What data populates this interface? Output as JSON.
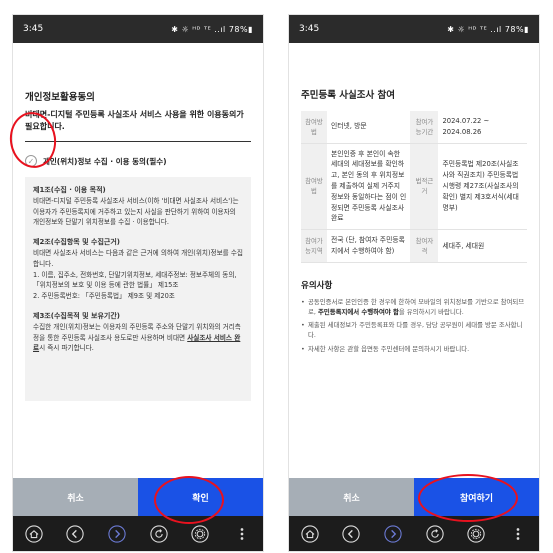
{
  "left": {
    "status": {
      "time": "3:45",
      "indicators": "✱ ☼ ᴴᴰ ᵀᴱ ..ıl 78%▮"
    },
    "title": "개인정보활용동의",
    "subtitle": "비대면-디지털 주민등록 사실조사 서비스 사용을 위한 이용동의가 필요합니다.",
    "check_label": "개인(위치)정보 수집 · 이용 동의(필수)",
    "terms": {
      "s1_title": "제1조(수집 · 이용 목적)",
      "s1_body": "비대면-디지털 주민등록 사실조사 서비스(이하 '비대면 사실조사 서비스')는 이용자가 주민등록지에 거주하고 있는지 사실을 판단하기 위하여 이용자의 개인정보와 단말기 위치정보를 수집 · 이용합니다.",
      "s2_title": "제2조(수집항목 및 수집근거)",
      "s2_body": "비대면 사실조사 서비스는 다음과 같은 근거에 의하여 개인(위치)정보를 수집합니다.",
      "s2_item1": "1. 이름, 집주소, 전화번호, 단말기위치정보, 세대주정보: 정보주체의 동의, 「위치정보의 보호 및 이용 등에 관한 법률」 제15조",
      "s2_item2": "2. 주민등록번호: 「주민등록법」 제9조 및 제20조",
      "s3_title": "제3조(수집목적 및 보유기간)",
      "s3_body": "수집한 개인(위치)정보는 이용자의 주민등록 주소와 단말기 위치와의 거리측정을 통한 주민등록 사실조사 용도로만 사용하며 비대면",
      "s3_underline": "사실조사 서비스 완료",
      "s3_tail": "시 즉시 파기합니다."
    },
    "cancel_label": "취소",
    "confirm_label": "확인"
  },
  "right": {
    "status": {
      "time": "3:45",
      "indicators": "✱ ☼ ᴴᴰ ᵀᴱ ..ıl 78%▮"
    },
    "title": "주민등록 사실조사 참여",
    "rows": [
      {
        "k1": "참여방법",
        "v1": "인터넷, 방문",
        "k2": "참여가능기간",
        "v2": "2024.07.22 ~ 2024.08.26"
      },
      {
        "k1": "참여방법",
        "v1": "본인인증 후 본인이 속한 세대의 세대정보를 확인하고, 본인 동의 후 위치정보를 제출하여 실제 거주지 정보와 동일하다는 점이 인정되면 주민등록 사실조사 완료",
        "k2": "법적근거",
        "v2": "주민등록법 제20조(사실조사와 직권조치) 주민등록법 시행령 제27조(사실조사의 확인) 별지 제3호서식(세대명부)"
      },
      {
        "k1": "참여가능지역",
        "v1": "전국 (단, 참여자 주민등록지에서 수행하여야 함)",
        "k2": "참여자격",
        "v2": "세대주, 세대원"
      }
    ],
    "notes_title": "유의사항",
    "notes": [
      {
        "pre": "공동인증서로 본인인증 한 경우에 한하여 모바일의 위치정보를 기반으로 참여되므로, ",
        "bold": "주민등록지에서 수행하여야 함",
        "post": "을 유의하시기 바랍니다."
      },
      {
        "pre": "제출된 세대정보가 주민등록표와 다를 경우, 담당 공무원이 세대를 방문 조사합니다.",
        "bold": "",
        "post": ""
      },
      {
        "pre": "자세한 사항은 관할 읍면동 주민센터에 문의하시기 바랍니다.",
        "bold": "",
        "post": ""
      }
    ],
    "cancel_label": "취소",
    "participate_label": "참여하기"
  },
  "colors": {
    "primary": "#1a52e6",
    "cancel": "#a6aeb6",
    "annotation": "#e8121f",
    "navbar": "#1c1c1c"
  }
}
